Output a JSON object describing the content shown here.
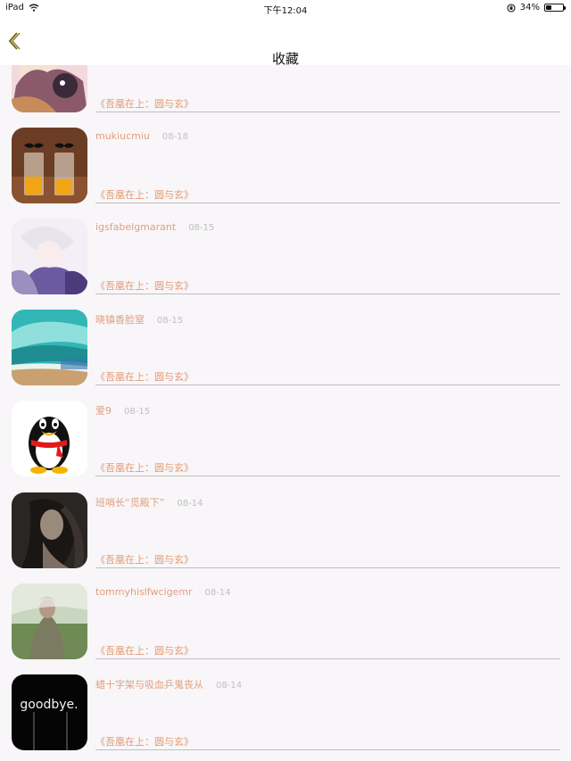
{
  "status_bar": {
    "device": "iPad",
    "time": "下午12:04",
    "battery": "34%",
    "battery_level": 0.34
  },
  "nav": {
    "title": "收藏",
    "back_icon": "chevron-left-icon",
    "accent": "#7a6a10"
  },
  "colors": {
    "username": "#e0a080",
    "book": "#e39a73",
    "date": "#c0c0c0",
    "background": "#f8f6f8"
  },
  "rows": [
    {
      "username": "",
      "date": "",
      "book": "《吾凰在上：圆与玄》",
      "avatar": "anime-avatar"
    },
    {
      "username": "mukiucmiu",
      "date": "08-18",
      "book": "《吾凰在上：圆与玄》",
      "avatar": "juice-mustache-avatar"
    },
    {
      "username": "igsfabelgmarant",
      "date": "08-15",
      "book": "《吾凰在上：圆与玄》",
      "avatar": "white-hair-anime-avatar"
    },
    {
      "username": "晓镇香脸窒",
      "date": "08-15",
      "book": "《吾凰在上：圆与玄》",
      "avatar": "ocean-wave-avatar"
    },
    {
      "username": "爱9",
      "date": "08-15",
      "book": "《吾凰在上：圆与玄》",
      "avatar": "penguin-avatar"
    },
    {
      "username": "班哨长“觅殿下”",
      "date": "08-14",
      "book": "《吾凰在上：圆与玄》",
      "avatar": "woman-portrait-avatar"
    },
    {
      "username": "tommyhislfwcigemr",
      "date": "08-14",
      "book": "《吾凰在上：圆与玄》",
      "avatar": "rain-field-avatar"
    },
    {
      "username": "蜡十字架与吸血乒鬼丧从",
      "date": "08-14",
      "book": "《吾凰在上：圆与玄》",
      "avatar": "goodbye-neon-avatar"
    },
    {
      "avatar_logo_text": "goodbye."
    }
  ]
}
